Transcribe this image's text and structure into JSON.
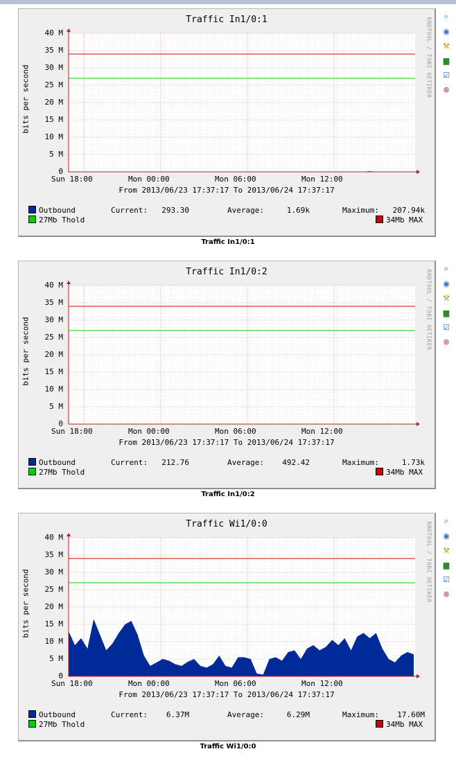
{
  "graphs": [
    {
      "title": "Traffic In1/0:1",
      "caption": "Traffic In1/0:1",
      "ylabel": "bits per second",
      "watermark": "RRDTOOL / TOBI OETIKER",
      "period": "From 2013/06/23 17:37:17 To 2013/06/24 17:37:17",
      "legend": {
        "outbound": "Outbound",
        "current_label": "Current:",
        "current": "293.30",
        "average_label": "Average:",
        "average": "1.69k",
        "maximum_label": "Maximum:",
        "maximum": "207.94k",
        "thold": "27Mb Thold",
        "max": "34Mb MAX"
      }
    },
    {
      "title": "Traffic In1/0:2",
      "caption": "Traffic In1/0:2",
      "ylabel": "bits per second",
      "watermark": "RRDTOOL / TOBI OETIKER",
      "period": "From 2013/06/23 17:37:17 To 2013/06/24 17:37:17",
      "legend": {
        "outbound": "Outbound",
        "current_label": "Current:",
        "current": "212.76",
        "average_label": "Average:",
        "average": "492.42",
        "maximum_label": "Maximum:",
        "maximum": "1.73k",
        "thold": "27Mb Thold",
        "max": "34Mb MAX"
      }
    },
    {
      "title": "Traffic Wi1/0:0",
      "caption": "Traffic Wi1/0:0",
      "ylabel": "bits per second",
      "watermark": "RRDTOOL / TOBI OETIKER",
      "period": "From 2013/06/23 17:37:17 To 2013/06/24 17:37:17",
      "legend": {
        "outbound": "Outbound",
        "current_label": "Current:",
        "current": "6.37M",
        "average_label": "Average:",
        "average": "6.29M",
        "maximum_label": "Maximum:",
        "maximum": "17.60M",
        "thold": "27Mb Thold",
        "max": "34Mb MAX"
      }
    }
  ],
  "axis": {
    "yticks": [
      "40 M",
      "35 M",
      "30 M",
      "25 M",
      "20 M",
      "15 M",
      "10 M",
      "5 M",
      "0"
    ],
    "xticks": [
      "Sun 18:00",
      "Mon 00:00",
      "Mon 06:00",
      "Mon 12:00"
    ]
  },
  "icons": [
    "zoom-icon",
    "nav-icon",
    "properties-icon",
    "chart-icon",
    "edit-icon",
    "delete-icon"
  ],
  "colors": {
    "outbound": "#002a97",
    "thold": "#00cf00",
    "max": "#d40000",
    "grid": "#ff9b9b"
  },
  "chart_data": [
    {
      "type": "area",
      "title": "Traffic In1/0:1",
      "ylabel": "bits per second",
      "ylim": [
        0,
        40000000
      ],
      "x_ticks": [
        "Sun 18:00",
        "Mon 00:00",
        "Mon 06:00",
        "Mon 12:00"
      ],
      "series": [
        {
          "name": "Outbound",
          "values": [
            0,
            0,
            0,
            0,
            0,
            0,
            0,
            0,
            0,
            0,
            0,
            0,
            0,
            0,
            0,
            0,
            0,
            0,
            0,
            0,
            0,
            0,
            0,
            0,
            0,
            0,
            0,
            0,
            0,
            0,
            0,
            0,
            0,
            0,
            0,
            0,
            0,
            0,
            0,
            0,
            0,
            207940,
            0,
            0,
            0,
            0,
            0,
            0
          ]
        },
        {
          "name": "27Mb Thold",
          "values": [
            27000000
          ]
        },
        {
          "name": "34Mb MAX",
          "values": [
            34000000
          ]
        }
      ]
    },
    {
      "type": "area",
      "title": "Traffic In1/0:2",
      "ylabel": "bits per second",
      "ylim": [
        0,
        40000000
      ],
      "x_ticks": [
        "Sun 18:00",
        "Mon 00:00",
        "Mon 06:00",
        "Mon 12:00"
      ],
      "series": [
        {
          "name": "Outbound",
          "values": [
            0,
            0,
            0,
            0,
            0,
            0,
            0,
            0,
            0,
            0,
            0,
            0,
            0,
            0,
            0,
            0,
            0,
            0,
            0,
            0,
            0,
            0,
            0,
            0,
            0,
            0,
            0,
            0,
            0,
            0,
            0,
            0,
            0,
            0,
            0,
            0,
            0,
            0,
            0,
            0,
            0,
            0,
            0,
            0,
            0,
            0,
            0,
            0
          ]
        },
        {
          "name": "27Mb Thold",
          "values": [
            27000000
          ]
        },
        {
          "name": "34Mb MAX",
          "values": [
            34000000
          ]
        }
      ]
    },
    {
      "type": "area",
      "title": "Traffic Wi1/0:0",
      "ylabel": "bits per second",
      "ylim": [
        0,
        40000000
      ],
      "x_ticks": [
        "Sun 18:00",
        "Mon 00:00",
        "Mon 06:00",
        "Mon 12:00"
      ],
      "series": [
        {
          "name": "Outbound",
          "values": [
            13000000,
            9000000,
            11000000,
            8000000,
            16500000,
            12000000,
            7500000,
            9500000,
            12500000,
            15000000,
            16000000,
            12000000,
            6000000,
            3000000,
            4000000,
            5000000,
            4500000,
            3500000,
            3000000,
            4200000,
            5000000,
            3000000,
            2500000,
            3500000,
            6000000,
            3000000,
            2500000,
            5500000,
            5500000,
            5000000,
            800000,
            500000,
            5000000,
            5500000,
            4500000,
            7000000,
            7500000,
            5000000,
            8000000,
            9000000,
            7500000,
            8500000,
            10500000,
            9000000,
            11000000,
            7500000,
            11500000,
            12500000,
            11000000,
            12500000,
            8000000,
            5000000,
            4000000,
            6000000,
            7000000,
            6370000
          ]
        },
        {
          "name": "27Mb Thold",
          "values": [
            27000000
          ]
        },
        {
          "name": "34Mb MAX",
          "values": [
            34000000
          ]
        }
      ]
    }
  ]
}
